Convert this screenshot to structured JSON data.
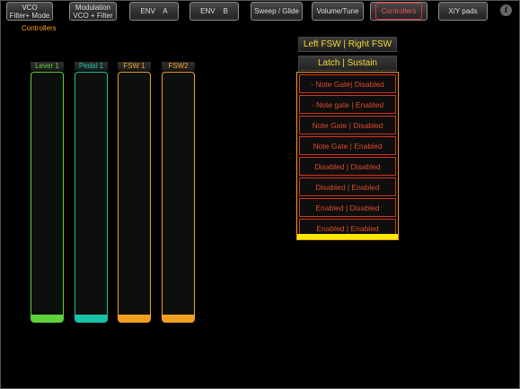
{
  "tabs": [
    {
      "line1": "VCO",
      "line2": "Filter+ Mode",
      "active": false
    },
    {
      "line1": "Modulation",
      "line2": "VCO + Filter",
      "active": false
    },
    {
      "line1": "ENV    A",
      "line2": "",
      "active": false
    },
    {
      "line1": "ENV    B",
      "line2": "",
      "active": false
    },
    {
      "line1": "Sweep / Glide",
      "line2": "",
      "active": false
    },
    {
      "line1": "Volume/Tune",
      "line2": "",
      "active": false
    },
    {
      "line1": "Controllers",
      "line2": "",
      "active": true
    },
    {
      "line1": "X/Y pads",
      "line2": "",
      "active": false
    }
  ],
  "info_icon": "info-icon",
  "section_label": "Controllers",
  "sliders": [
    {
      "label": "Lever 1",
      "color": "#5fd13a",
      "level": 0.03
    },
    {
      "label": "Pedal 1",
      "color": "#19c2a8",
      "level": 0.03
    },
    {
      "label": "FSW 1",
      "color": "#f0a020",
      "level": 0.03
    },
    {
      "label": "FSW2",
      "color": "#f0a020",
      "level": 0.03
    }
  ],
  "fsw_header": "Left FSW | Right FSW",
  "mode_header": "Latch | Sustain",
  "modes": [
    "- Note Gate| Disabled",
    "- Note gate | Enabled",
    "Note Gate | Disabled",
    "Note Gate | Enabled",
    "Disabled | Disabled",
    "Disabled | Enabled",
    "Enabled | Disabled",
    "Enabled | Enabled"
  ],
  "colors": {
    "accent": "#f0a020",
    "mode_text": "#e04a2c",
    "header_text": "#f2d830",
    "scroll": "#ffe800"
  }
}
